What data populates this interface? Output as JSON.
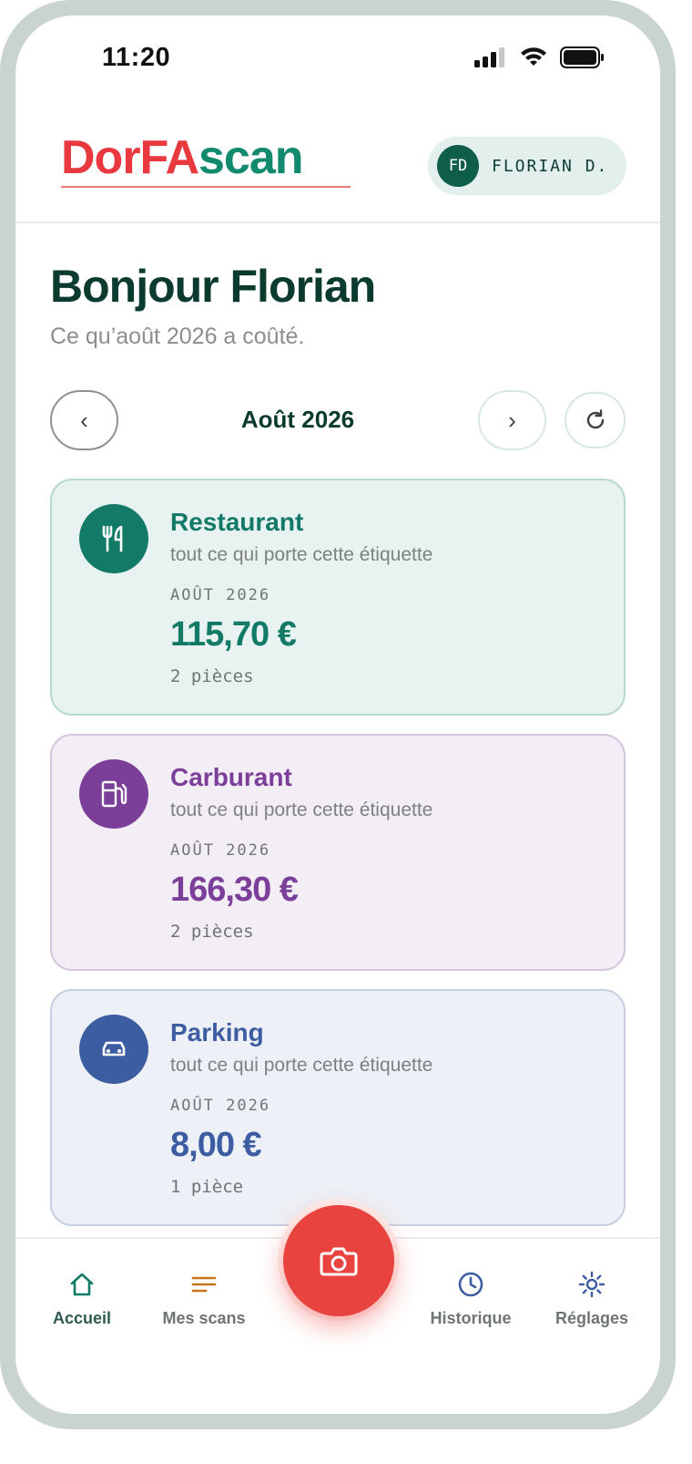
{
  "status_bar": {
    "time": "11:20"
  },
  "header": {
    "logo_part1": "DorFA",
    "logo_part2": "scan",
    "user_initials": "FD",
    "user_name": "FLORIAN D."
  },
  "greeting": {
    "title": "Bonjour Florian",
    "subtitle": "Ce qu’août 2026 a coûté."
  },
  "month_nav": {
    "prev_label": "‹",
    "next_label": "›",
    "current_month": "Août 2026"
  },
  "cards": [
    {
      "title": "Restaurant",
      "description": "tout ce qui porte cette étiquette",
      "period": "AOÛT 2026",
      "amount": "115,70 €",
      "count": "2 pièces",
      "icon": "fork-knife-icon",
      "color": "#137a67"
    },
    {
      "title": "Carburant",
      "description": "tout ce qui porte cette étiquette",
      "period": "AOÛT 2026",
      "amount": "166,30 €",
      "count": "2 pièces",
      "icon": "fuel-pump-icon",
      "color": "#7b3f9a"
    },
    {
      "title": "Parking",
      "description": "tout ce qui porte cette étiquette",
      "period": "AOÛT 2026",
      "amount": "8,00 €",
      "count": "1 pièce",
      "icon": "car-icon",
      "color": "#3c5da2"
    }
  ],
  "bottom_nav": {
    "home": "Accueil",
    "scans": "Mes scans",
    "history": "Historique",
    "settings": "Réglages"
  },
  "colors": {
    "accent_red": "#e9433f",
    "brand_teal": "#128a6e",
    "dark_green": "#0b3a2f"
  }
}
